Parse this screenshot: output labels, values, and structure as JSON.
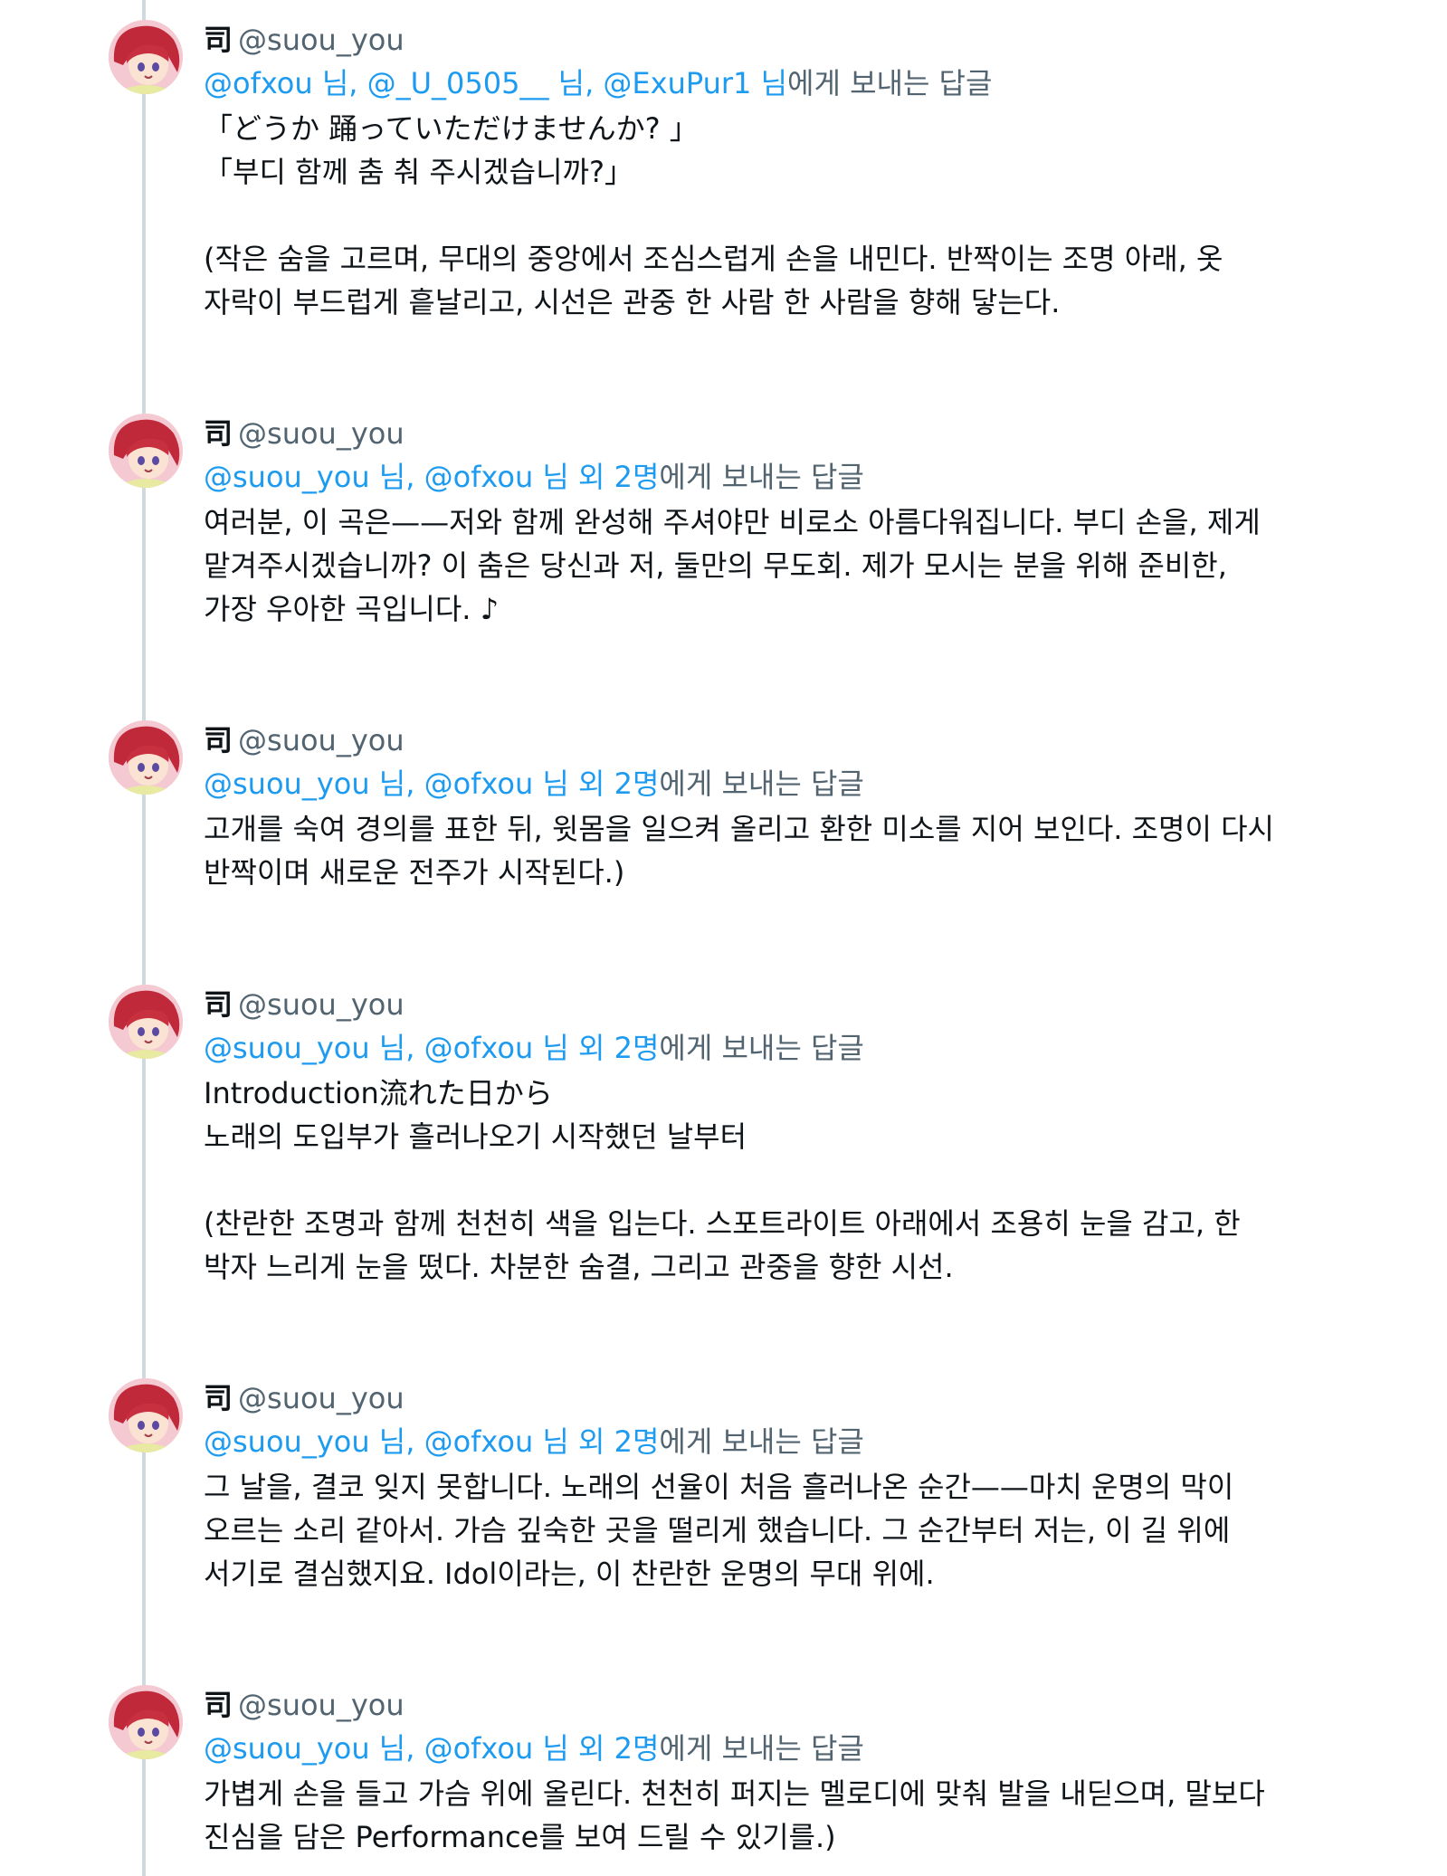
{
  "thread": {
    "tweets": [
      {
        "display_name": "司",
        "handle": "@suou_you",
        "mentions": "@ofxou 님, @_U_0505__ 님, @ExuPur1 님",
        "replying_suffix": "에게 보내는 답글",
        "text": "「どうか 踊っていただけませんか? 」\n「부디 함께 춤 춰 주시겠습니까?」\n\n(작은 숨을 고르며, 무대의 중앙에서 조심스럽게 손을 내민다. 반짝이는 조명 아래, 옷\n자락이 부드럽게 흩날리고, 시선은 관중 한 사람 한 사람을 향해 닿는다."
      },
      {
        "display_name": "司",
        "handle": "@suou_you",
        "mentions": "@suou_you 님, @ofxou 님 외 2명",
        "replying_suffix": "에게 보내는 답글",
        "text": "여러분, 이 곡은——저와 함께 완성해 주셔야만 비로소 아름다워집니다. 부디 손을, 제게\n맡겨주시겠습니까? 이 춤은 당신과 저, 둘만의 무도회. 제가 모시는 분을 위해 준비한,\n가장 우아한 곡입니다. ♪"
      },
      {
        "display_name": "司",
        "handle": "@suou_you",
        "mentions": "@suou_you 님, @ofxou 님 외 2명",
        "replying_suffix": "에게 보내는 답글",
        "text": "고개를 숙여 경의를 표한 뒤, 윗몸을 일으켜 올리고 환한 미소를 지어 보인다. 조명이 다시\n반짝이며 새로운 전주가 시작된다.)"
      },
      {
        "display_name": "司",
        "handle": "@suou_you",
        "mentions": "@suou_you 님, @ofxou 님 외 2명",
        "replying_suffix": "에게 보내는 답글",
        "text": "Introduction流れた日から\n노래의 도입부가 흘러나오기 시작했던 날부터\n\n(찬란한 조명과 함께 천천히 색을 입는다. 스포트라이트 아래에서 조용히 눈을 감고, 한\n박자 느리게 눈을 떴다. 차분한 숨결, 그리고 관중을 향한 시선."
      },
      {
        "display_name": "司",
        "handle": "@suou_you",
        "mentions": "@suou_you 님, @ofxou 님 외 2명",
        "replying_suffix": "에게 보내는 답글",
        "text": "그 날을, 결코 잊지 못합니다. 노래의 선율이 처음 흘러나온 순간——마치 운명의 막이\n오르는 소리 같아서. 가슴 깊숙한 곳을 떨리게 했습니다. 그 순간부터 저는, 이 길 위에\n서기로 결심했지요. Idol이라는, 이 찬란한 운명의 무대 위에."
      },
      {
        "display_name": "司",
        "handle": "@suou_you",
        "mentions": "@suou_you 님, @ofxou 님 외 2명",
        "replying_suffix": "에게 보내는 답글",
        "text": "가볍게 손을 들고 가슴 위에 올린다. 천천히 퍼지는 멜로디에 맞춰 발을 내딛으며, 말보다\n진심을 담은 Performance를 보여 드릴 수 있기를.)"
      }
    ]
  }
}
